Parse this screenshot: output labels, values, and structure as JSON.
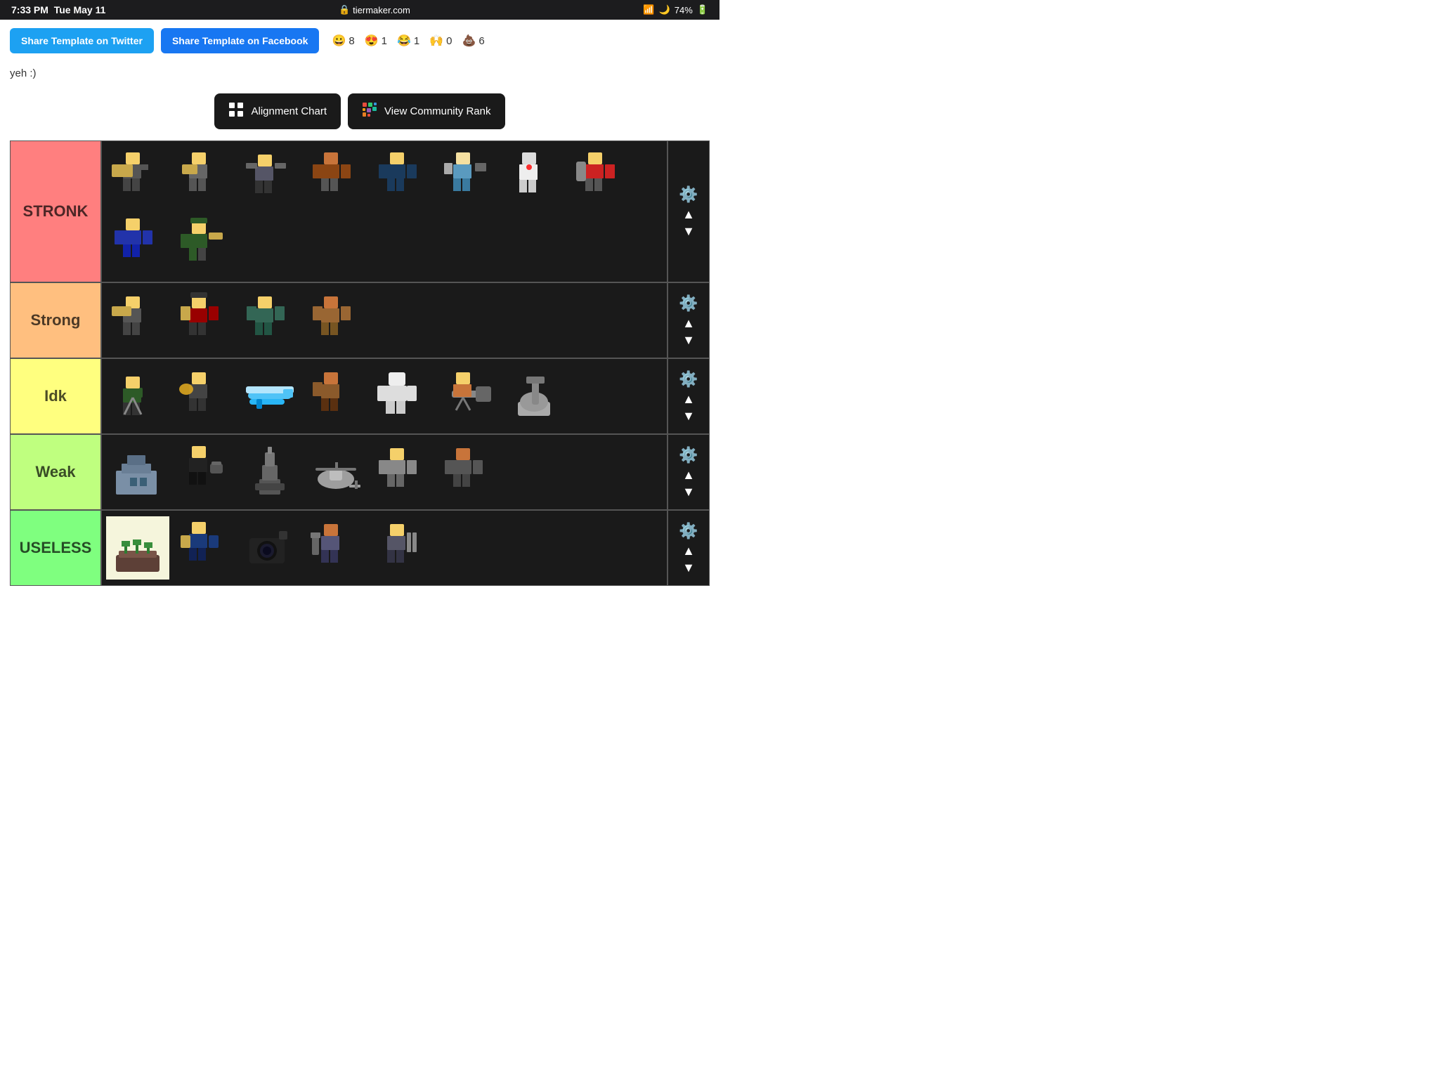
{
  "statusBar": {
    "time": "7:33 PM",
    "date": "Tue May 11",
    "url": "tiermaker.com",
    "battery": "74%"
  },
  "buttons": {
    "twitter": "Share Template on Twitter",
    "facebook": "Share Template on Facebook"
  },
  "reactions": [
    {
      "emoji": "😀",
      "count": "8"
    },
    {
      "emoji": "😍",
      "count": "1"
    },
    {
      "emoji": "😂",
      "count": "1"
    },
    {
      "emoji": "🙌",
      "count": "0"
    },
    {
      "emoji": "💩",
      "count": "6"
    }
  ],
  "description": "yeh :)",
  "actions": {
    "alignmentChart": "Alignment Chart",
    "viewCommunityRank": "View Community Rank"
  },
  "tiers": [
    {
      "id": "stronk",
      "label": "STRONK",
      "colorClass": "stronk",
      "itemCount": 10
    },
    {
      "id": "strong",
      "label": "Strong",
      "colorClass": "strong",
      "itemCount": 4
    },
    {
      "id": "idk",
      "label": "Idk",
      "colorClass": "idk",
      "itemCount": 7
    },
    {
      "id": "weak",
      "label": "Weak",
      "colorClass": "weak",
      "itemCount": 6
    },
    {
      "id": "useless",
      "label": "USELESS",
      "colorClass": "useless",
      "itemCount": 5
    }
  ]
}
